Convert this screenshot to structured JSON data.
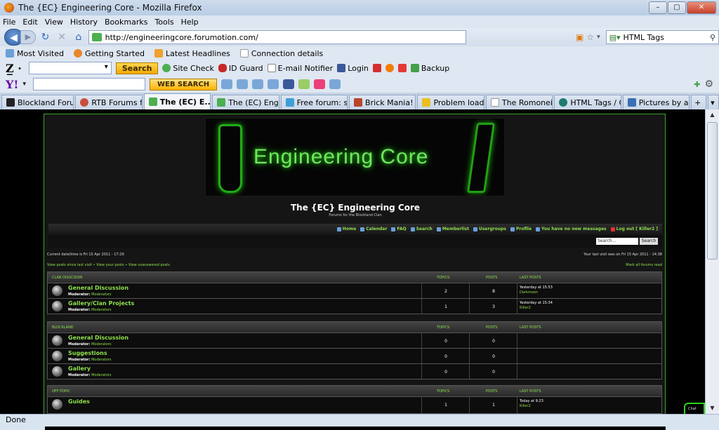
{
  "window": {
    "title": "The {EC} Engineering Core - Mozilla Firefox"
  },
  "menu": [
    "File",
    "Edit",
    "View",
    "History",
    "Bookmarks",
    "Tools",
    "Help"
  ],
  "nav": {
    "url": "http://engineeringcore.forumotion.com/",
    "search_value": "HTML Tags"
  },
  "bookmarks": [
    {
      "label": "Most Visited",
      "color": "#6aa0d8"
    },
    {
      "label": "Getting Started",
      "color": "#e8872a"
    },
    {
      "label": "Latest Headlines",
      "color": "#f0a030"
    },
    {
      "label": "Connection details",
      "color": "#ffffff"
    }
  ],
  "toolbar1": {
    "search_btn": "Search",
    "items": [
      "Site Check",
      "ID Guard",
      "E-mail Notifier",
      "Login",
      "Backup"
    ]
  },
  "toolbar2": {
    "web_search": "WEB SEARCH"
  },
  "tabs": [
    {
      "label": "Blockland Foru...",
      "color": "#222222",
      "active": false
    },
    {
      "label": "RTB Forums fo...",
      "color": "#c94d3d",
      "active": false
    },
    {
      "label": "The (EC) E...",
      "color": "#4caf50",
      "active": true
    },
    {
      "label": "The (EC) Engin...",
      "color": "#4caf50",
      "active": false
    },
    {
      "label": "Free forum: su...",
      "color": "#3ca0d8",
      "active": false
    },
    {
      "label": "Brick Mania!",
      "color": "#b8452a",
      "active": false
    },
    {
      "label": "Problem loadin...",
      "color": "#e8c020",
      "active": false
    },
    {
      "label": "The Romoneia...",
      "color": "#ffffff",
      "active": false
    },
    {
      "label": "HTML Tags / C...",
      "color": "#1e7a6e",
      "active": false
    },
    {
      "label": "Pictures by and...",
      "color": "#3a6fb5",
      "active": false
    }
  ],
  "forum": {
    "banner_text": "Engineering Core",
    "title": "The {EC} Engineering Core",
    "subtitle": "Forums for the Blockland Clan",
    "nav": [
      "Home",
      "Calendar",
      "FAQ",
      "Search",
      "Memberlist",
      "Usergroups",
      "Profile",
      "You have no new messages",
      "Log out [ Killer2 ]"
    ],
    "search_placeholder": "Search...",
    "search_btn": "Search",
    "datetime": "Current date/time is Fri 15 Apr 2011 - 17:29",
    "last_visit": "Your last visit was on Fri 15 Apr 2011 - 14:38",
    "view_links": "View posts since last visit • View your posts • View unanswered posts",
    "mark_read": "Mark all forums read",
    "col_topics": "TOPICS",
    "col_posts": "POSTS",
    "col_last": "LAST POSTS",
    "categories": [
      {
        "name": "CLAN DISUCSION",
        "forums": [
          {
            "name": "General Discussion",
            "mod_label": "Moderator:",
            "mod": "Moderators",
            "topics": "2",
            "posts": "8",
            "last_time": "Yesterday at 15:53",
            "last_user": "Darkmoon"
          },
          {
            "name": "Gallery/Clan Projects",
            "mod_label": "Moderator:",
            "mod": "Moderators",
            "topics": "1",
            "posts": "3",
            "last_time": "Yesterday at 15:34",
            "last_user": "Killer2"
          }
        ]
      },
      {
        "name": "BLOCKLAND",
        "forums": [
          {
            "name": "General Discussion",
            "mod_label": "Moderator:",
            "mod": "Moderators",
            "topics": "0",
            "posts": "0",
            "last_time": "",
            "last_user": ""
          },
          {
            "name": "Suggestions",
            "mod_label": "Moderator:",
            "mod": "Moderators",
            "topics": "0",
            "posts": "0",
            "last_time": "",
            "last_user": ""
          },
          {
            "name": "Gallery",
            "mod_label": "Moderator:",
            "mod": "Moderators",
            "topics": "0",
            "posts": "0",
            "last_time": "",
            "last_user": ""
          }
        ]
      },
      {
        "name": "OFF-TOPIC",
        "forums": [
          {
            "name": "Guides",
            "mod_label": "",
            "mod": "",
            "topics": "1",
            "posts": "1",
            "last_time": "Today at 9:23",
            "last_user": "Killer2"
          }
        ]
      }
    ]
  },
  "chat_label": "Chat",
  "status": "Done",
  "colors": {
    "accent": "#8fe14d",
    "border": "#3aa52a"
  }
}
